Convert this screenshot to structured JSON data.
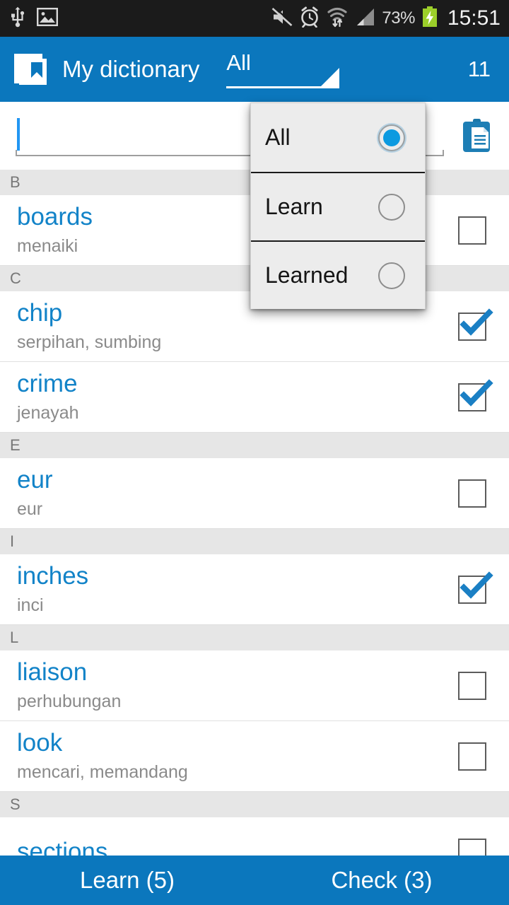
{
  "status_bar": {
    "icons_left": [
      "usb-icon",
      "screenshot-image-icon"
    ],
    "icons_right": [
      "mute-icon",
      "alarm-clock-icon",
      "wifi-transfer-icon",
      "signal-bars-icon",
      "battery-charging-icon"
    ],
    "battery_percent": "73%",
    "clock": "15:51"
  },
  "action_bar": {
    "logo": "book-bookmark-icon",
    "title": "My dictionary",
    "spinner_value": "All",
    "count": "11"
  },
  "search": {
    "value": "",
    "placeholder": "",
    "paste_icon": "clipboard-paste-icon"
  },
  "dropdown": {
    "visible": true,
    "items": [
      {
        "label": "All",
        "selected": true
      },
      {
        "label": "Learn",
        "selected": false
      },
      {
        "label": "Learned",
        "selected": false
      }
    ]
  },
  "list": [
    {
      "type": "section",
      "letter": "B"
    },
    {
      "type": "word",
      "term": "boards",
      "translation": "menaiki",
      "checked": false
    },
    {
      "type": "section",
      "letter": "C"
    },
    {
      "type": "word",
      "term": "chip",
      "translation": "serpihan, sumbing",
      "checked": true
    },
    {
      "type": "word",
      "term": "crime",
      "translation": "jenayah",
      "checked": true
    },
    {
      "type": "section",
      "letter": "E"
    },
    {
      "type": "word",
      "term": "eur",
      "translation": "eur",
      "checked": false
    },
    {
      "type": "section",
      "letter": "I"
    },
    {
      "type": "word",
      "term": "inches",
      "translation": "inci",
      "checked": true
    },
    {
      "type": "section",
      "letter": "L"
    },
    {
      "type": "word",
      "term": "liaison",
      "translation": "perhubungan",
      "checked": false
    },
    {
      "type": "word",
      "term": "look",
      "translation": "mencari, memandang",
      "checked": false
    },
    {
      "type": "section",
      "letter": "S"
    },
    {
      "type": "word",
      "term": "sections",
      "translation": "",
      "checked": false
    }
  ],
  "bottom_bar": {
    "learn_label": "Learn (5)",
    "check_label": "Check (3)"
  },
  "colors": {
    "accent_blue": "#0b77bd",
    "term_blue": "#1283c8",
    "status_bar": "#1b1b1b",
    "section_gray": "#e6e6e6",
    "radio_blue": "#0c9ae0"
  }
}
